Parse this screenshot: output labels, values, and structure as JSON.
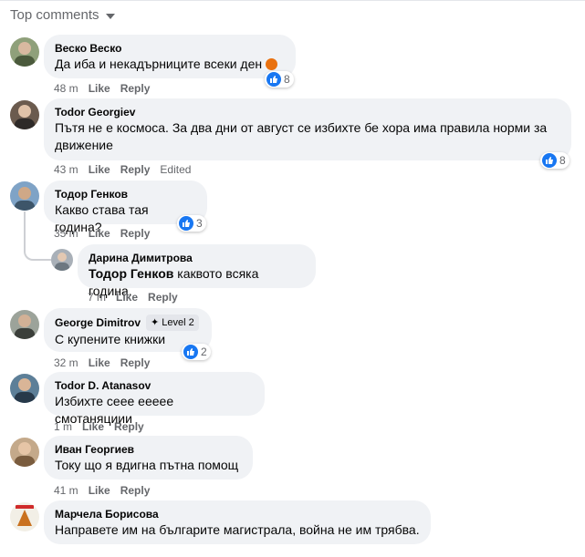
{
  "header": {
    "sort_label": "Top comments"
  },
  "comments": [
    {
      "author": "Веско Веско",
      "text": "Да иба и некадърниците всеки ден",
      "time": "48 m",
      "like": "Like",
      "reply": "Reply",
      "reactions": "8",
      "emoji": "angry-face"
    },
    {
      "author": "Todor Georgiev",
      "text": "Пътя не е космоса. За два дни от август се избихте бе хора има правила норми за движение",
      "time": "43 m",
      "like": "Like",
      "reply": "Reply",
      "edited": "Edited",
      "reactions": "8"
    },
    {
      "author": "Тодор Генков",
      "text": "Какво става тая година?",
      "time": "35 m",
      "like": "Like",
      "reply": "Reply",
      "reactions": "3"
    },
    {
      "author": "Дарина Димитрова",
      "mention": "Тодор Генков",
      "text": " каквото всяка година.",
      "time": "7 m",
      "like": "Like",
      "reply": "Reply"
    },
    {
      "author": "George Dimitrov",
      "badge": "Level 2",
      "text": "С купените книжки",
      "time": "32 m",
      "like": "Like",
      "reply": "Reply",
      "reactions": "2"
    },
    {
      "author": "Todor D. Atanasov",
      "text": "Избихте сеее ееееe смотаняциии",
      "time": "1 m",
      "like": "Like",
      "reply": "Reply"
    },
    {
      "author": "Иван Георгиев",
      "text": "Току що я вдигна пътна помощ",
      "time": "41 m",
      "like": "Like",
      "reply": "Reply"
    },
    {
      "author": "Марчела Борисова",
      "text": "Направете им на българите магистрала, война не им трябва."
    }
  ],
  "colors": {
    "like_blue": "#1877f2",
    "bubble_bg": "#f0f2f5",
    "meta_gray": "#65676b"
  }
}
